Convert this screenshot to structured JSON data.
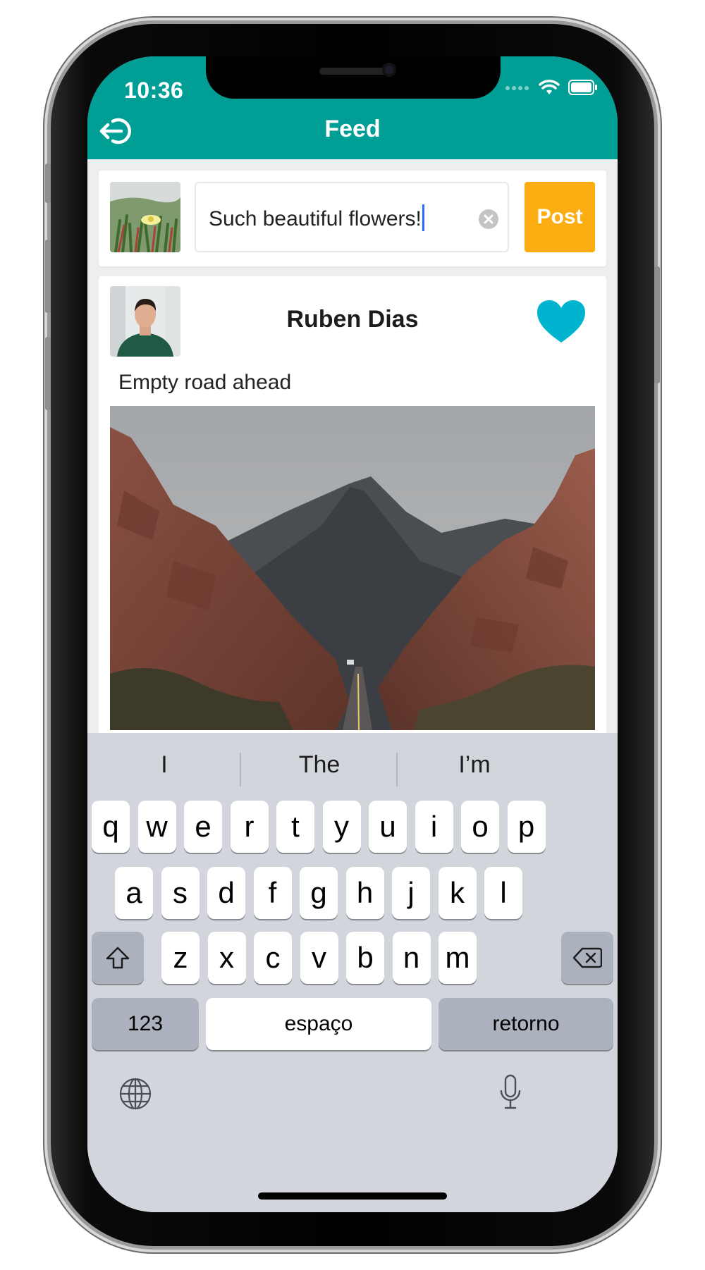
{
  "status_bar": {
    "time": "10:36"
  },
  "nav": {
    "title": "Feed"
  },
  "composer": {
    "input_value": "Such beautiful flowers!",
    "post_label": "Post"
  },
  "post": {
    "author_name": "Ruben Dias",
    "caption": "Empty road ahead",
    "liked": true
  },
  "keyboard": {
    "suggestions": [
      "I",
      "The",
      "I’m"
    ],
    "row1": [
      "q",
      "w",
      "e",
      "r",
      "t",
      "y",
      "u",
      "i",
      "o",
      "p"
    ],
    "row2": [
      "a",
      "s",
      "d",
      "f",
      "g",
      "h",
      "j",
      "k",
      "l"
    ],
    "row3": [
      "z",
      "x",
      "c",
      "v",
      "b",
      "n",
      "m"
    ],
    "numbers_label": "123",
    "space_label": "espaço",
    "return_label": "retorno"
  },
  "colors": {
    "header": "#009e94",
    "post_button": "#fbad12",
    "heart": "#00b4d0",
    "keyboard_bg": "#d2d5db"
  },
  "icons": [
    "logout-icon",
    "wifi-icon",
    "battery-icon",
    "clear-text-icon",
    "heart-icon",
    "shift-icon",
    "backspace-icon",
    "globe-icon",
    "microphone-icon"
  ]
}
